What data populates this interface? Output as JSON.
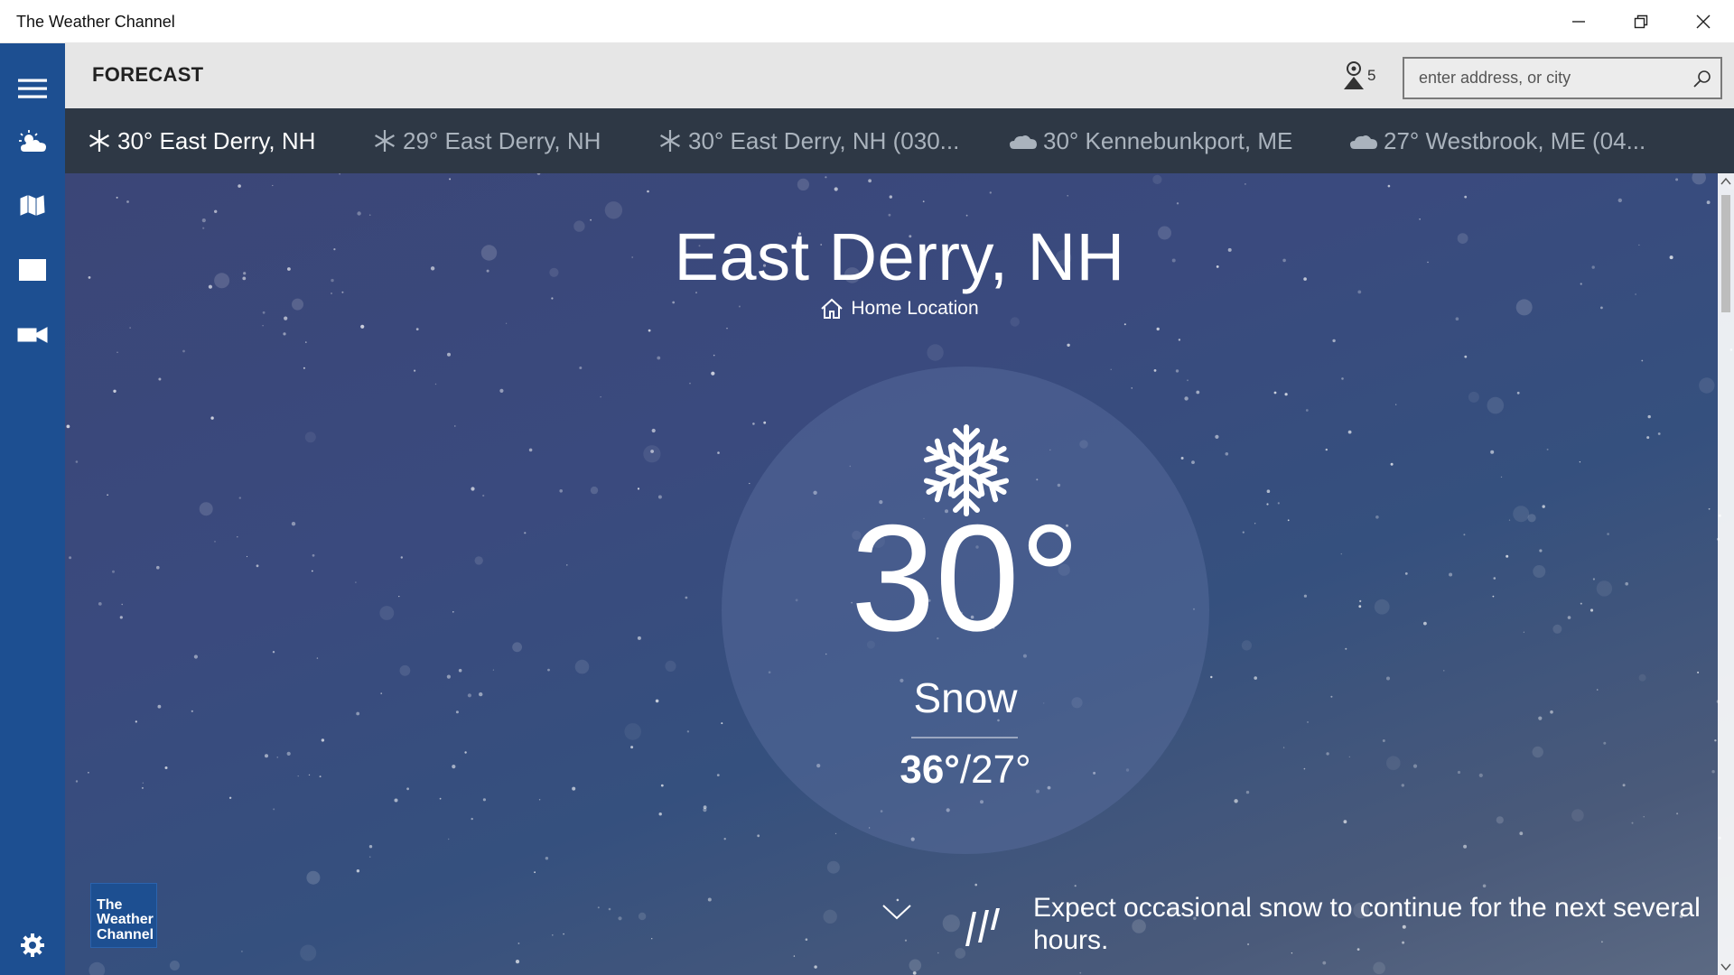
{
  "window": {
    "title": "The Weather Channel",
    "controls": [
      "minimize",
      "restore",
      "close"
    ]
  },
  "nav_rail": {
    "items": [
      {
        "name": "menu",
        "icon": "hamburger-icon"
      },
      {
        "name": "forecast",
        "icon": "partly-cloudy-icon"
      },
      {
        "name": "maps",
        "icon": "map-icon"
      },
      {
        "name": "news",
        "icon": "layout-icon"
      },
      {
        "name": "video",
        "icon": "video-camera-icon"
      }
    ],
    "settings_icon": "gear-icon"
  },
  "header": {
    "title": "FORECAST",
    "location_count": "5",
    "search_placeholder": "enter address, or city"
  },
  "locations": [
    {
      "label": "30° East Derry, NH",
      "icon": "snowflake-icon",
      "active": true
    },
    {
      "label": "29° East Derry, NH",
      "icon": "snowflake-icon",
      "active": false
    },
    {
      "label": "30° East Derry, NH (030...",
      "icon": "snowflake-icon",
      "active": false
    },
    {
      "label": "30° Kennebunkport, ME",
      "icon": "cloud-icon",
      "active": false
    },
    {
      "label": "27° Westbrook, ME (04...",
      "icon": "cloud-icon",
      "active": false
    }
  ],
  "current": {
    "city": "East Derry, NH",
    "home_label": "Home Location",
    "temperature": "30°",
    "condition": "Snow",
    "high": "36°",
    "low": "/27°",
    "summary": "Expect occasional snow to continue for the next several hours."
  },
  "logo": {
    "text_line1": "The",
    "text_line2": "Weather",
    "text_line3": "Channel"
  },
  "colors": {
    "rail": "#1d4f91",
    "header": "#e6e6e6",
    "location_strip": "#2e3845",
    "sky": "#3a4a7e"
  }
}
